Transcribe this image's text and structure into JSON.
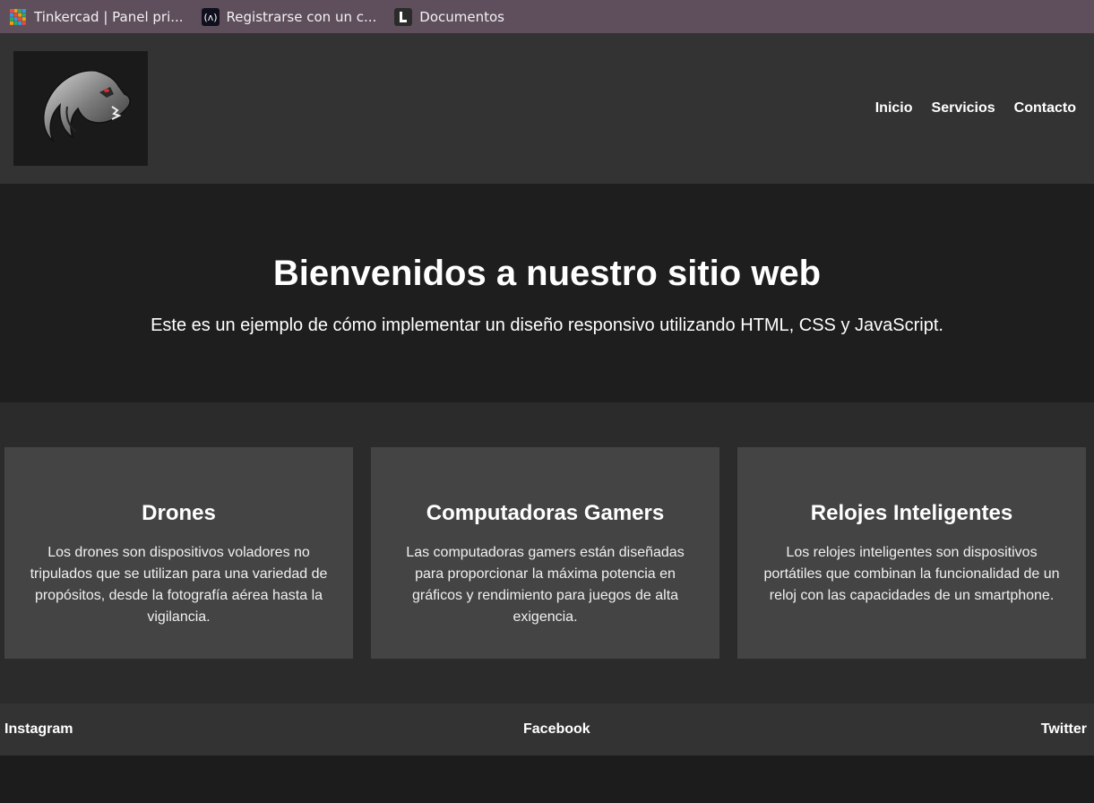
{
  "bookmarks": [
    {
      "label": "Tinkercad | Panel pri...",
      "icon": "tinkercad-icon"
    },
    {
      "label": "Registrarse con un c...",
      "icon": "registrarse-icon"
    },
    {
      "label": "Documentos",
      "icon": "documentos-icon"
    }
  ],
  "header": {
    "logo": "dragon-logo",
    "nav": [
      "Inicio",
      "Servicios",
      "Contacto"
    ]
  },
  "hero": {
    "title": "Bienvenidos a nuestro sitio web",
    "subtitle": "Este es un ejemplo de cómo implementar un diseño responsivo utilizando HTML, CSS y JavaScript."
  },
  "cards": [
    {
      "title": "Drones",
      "text": "Los drones son dispositivos voladores no tripulados que se utilizan para una variedad de propósitos, desde la fotografía aérea hasta la vigilancia."
    },
    {
      "title": "Computadoras Gamers",
      "text": "Las computadoras gamers están diseñadas para proporcionar la máxima potencia en gráficos y rendimiento para juegos de alta exigencia."
    },
    {
      "title": "Relojes Inteligentes",
      "text": "Los relojes inteligentes son dispositivos portátiles que combinan la funcionalidad de un reloj con las capacidades de un smartphone."
    }
  ],
  "footer": {
    "links": [
      "Instagram",
      "Facebook",
      "Twitter"
    ]
  },
  "colors": {
    "bookmarks_bar": "#5f4f5d",
    "header_bg": "#333333",
    "hero_bg": "#1e1e1e",
    "cards_section_bg": "#2b2b2b",
    "card_bg": "#444444",
    "text": "#ffffff"
  }
}
